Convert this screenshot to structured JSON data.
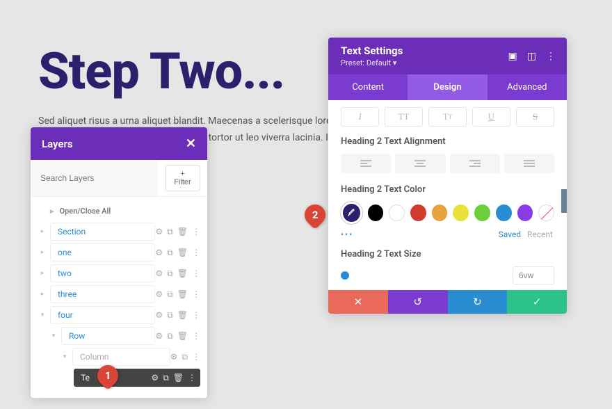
{
  "page": {
    "title": "Step Two...",
    "body": "Sed aliquet risus a urna aliquet blandit. Maecenas a scelerisque lorem. Sed nec finibus ligula. Proin elementum dui tincidunt. Nunc in tortor ut leo viverra lacinia. In lacinia, gravida nibh id, semper."
  },
  "layers": {
    "title": "Layers",
    "search_placeholder": "Search Layers",
    "filter_label": "+ Filter",
    "open_close_all": "Open/Close All",
    "items": {
      "section": "Section",
      "one": "one",
      "two": "two",
      "three": "three",
      "four": "four",
      "row": "Row",
      "column": "Column",
      "text": "Te"
    }
  },
  "settings": {
    "title": "Text Settings",
    "preset": "Preset: Default ▾",
    "tabs": {
      "content": "Content",
      "design": "Design",
      "advanced": "Advanced"
    },
    "h2_alignment_label": "Heading 2 Text Alignment",
    "h2_color_label": "Heading 2 Text Color",
    "h2_size_label": "Heading 2 Text Size",
    "swatch_sub": {
      "saved": "Saved",
      "recent": "Recent"
    },
    "size_value": "6vw",
    "colors": {
      "active": "#2d1f6b",
      "black": "#000000",
      "white": "#ffffff",
      "red": "#d23b2f",
      "orange": "#e8a23b",
      "yellow": "#e8e23b",
      "green": "#6ccf3a",
      "blue": "#2a8dd2",
      "purple": "#8a3be8"
    }
  },
  "callouts": {
    "one": "1",
    "two": "2"
  }
}
